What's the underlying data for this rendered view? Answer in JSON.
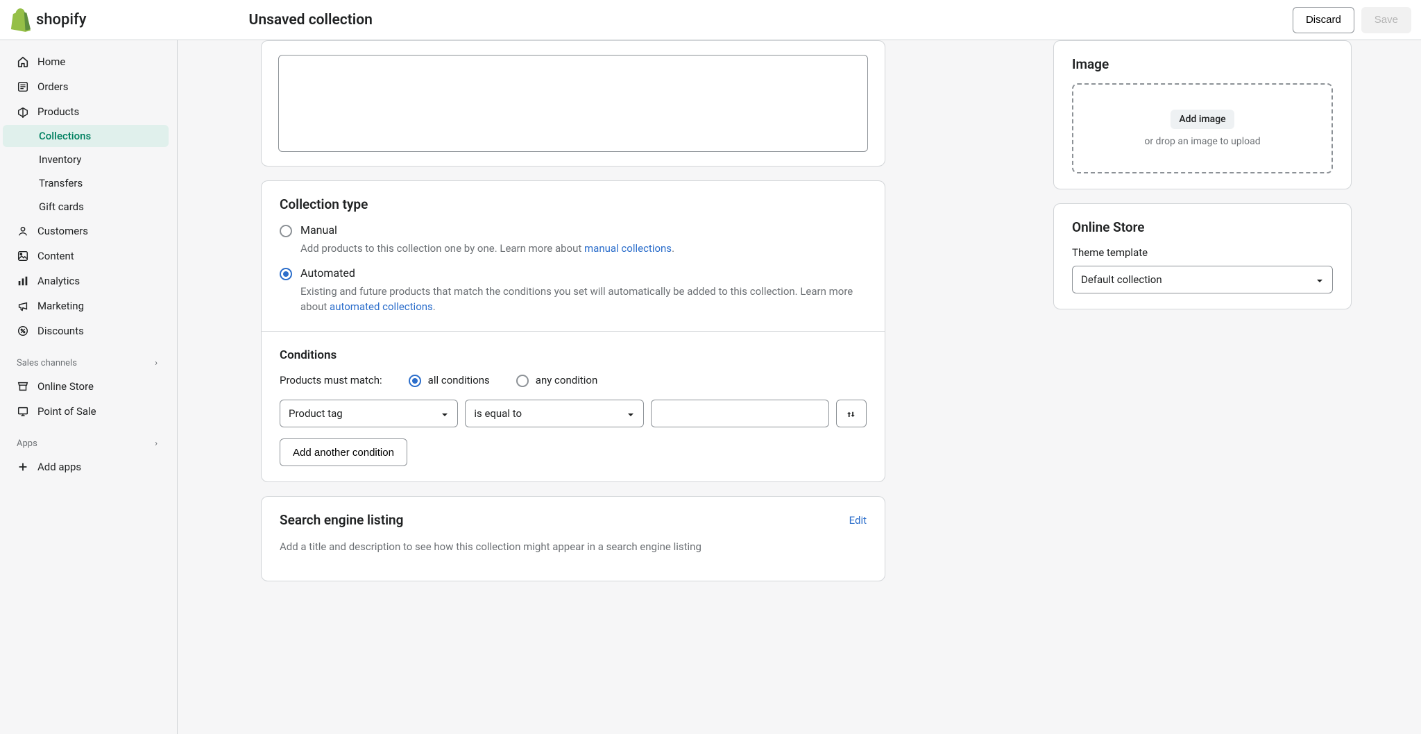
{
  "topbar": {
    "page_title": "Unsaved collection",
    "discard_label": "Discard",
    "save_label": "Save"
  },
  "nav": {
    "home": "Home",
    "orders": "Orders",
    "products": "Products",
    "products_sub": {
      "collections": "Collections",
      "inventory": "Inventory",
      "transfers": "Transfers",
      "gift_cards": "Gift cards"
    },
    "customers": "Customers",
    "content": "Content",
    "analytics": "Analytics",
    "marketing": "Marketing",
    "discounts": "Discounts",
    "sections": {
      "sales_channels": "Sales channels"
    },
    "online_store": "Online Store",
    "point_of_sale": "Point of Sale",
    "apps": "Apps",
    "add_apps": "Add apps"
  },
  "collection_type": {
    "heading": "Collection type",
    "manual": {
      "label": "Manual",
      "desc_prefix": "Add products to this collection one by one. Learn more about ",
      "desc_link": "manual collections",
      "desc_suffix": "."
    },
    "automated": {
      "label": "Automated",
      "desc_prefix": "Existing and future products that match the conditions you set will automatically be added to this collection. Learn more about ",
      "desc_link": "automated collections",
      "desc_suffix": "."
    }
  },
  "conditions": {
    "heading": "Conditions",
    "match_label": "Products must match:",
    "all_label": "all conditions",
    "any_label": "any condition",
    "select_field": "Product tag",
    "select_operator": "is equal to",
    "value": "",
    "add_button": "Add another condition"
  },
  "seo": {
    "heading": "Search engine listing",
    "edit": "Edit",
    "placeholder": "Add a title and description to see how this collection might appear in a search engine listing"
  },
  "image_panel": {
    "heading": "Image",
    "add_button": "Add image",
    "hint": "or drop an image to upload"
  },
  "online_store_panel": {
    "heading": "Online Store",
    "theme_label": "Theme template",
    "theme_value": "Default collection"
  }
}
